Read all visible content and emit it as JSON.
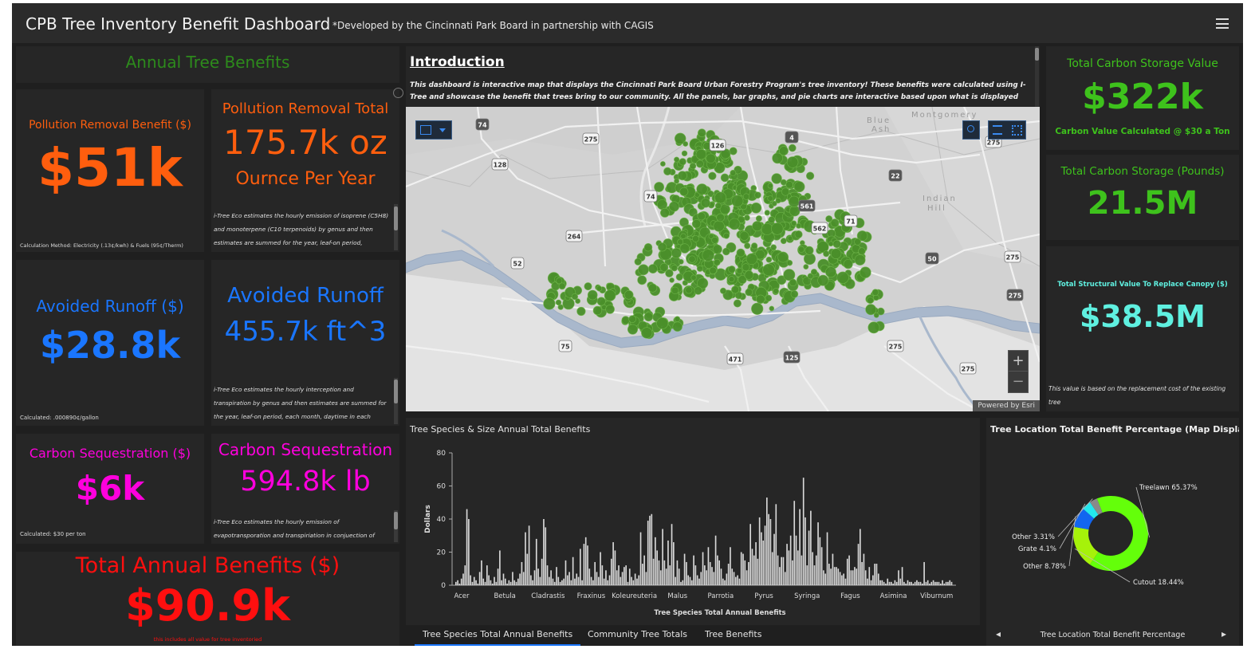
{
  "header": {
    "title": "CPB Tree Inventory Benefit Dashboard",
    "subtitle": "*Developed by the Cincinnati Park Board in partnership with CAGIS"
  },
  "annual_benefits": {
    "title": "Annual Tree Benefits"
  },
  "pollution_benefit": {
    "label": "Pollution Removal Benefit ($)",
    "value": "$51k",
    "method": "Calculation Method: Electricity (.13¢/kwh) & Fuels (95¢/Therm)"
  },
  "pollution_total": {
    "label": "Pollution Removal Total",
    "value": "175.7k oz",
    "unit": "Ournce Per Year",
    "note": "i-Tree Eco estimates the hourly emission of isoprene (C5H8) and monoterpene (C10 terpenoids) by genus and then estimates are summed for the year, leaf-on period,"
  },
  "runoff_benefit": {
    "label": "Avoided Runoff ($)",
    "value": "$28.8k",
    "method": "Calculated: .000890¢/gallon"
  },
  "runoff_total": {
    "label": "Avoided Runoff",
    "value": "455.7k ft^3",
    "note": "i-Tree Eco estimates the hourly interception and transpiration by genus and then  estimates are summed for the year, leaf-on period, each month, daytime in each"
  },
  "carbon_seq_benefit": {
    "label": "Carbon Sequestration ($)",
    "value": "$6k",
    "method": "Calculated: $30 per ton"
  },
  "carbon_seq_total": {
    "label": "Carbon Sequestration",
    "value": "594.8k lb",
    "note": "i-Tree Eco estimates the hourly emission of evapotransporation and transpiriation in conjuection of"
  },
  "total_benefits": {
    "label": "Total Annual Benefits ($)",
    "value": "$90.9k",
    "note": "this includes all value for tree inventoried"
  },
  "intro": {
    "title": "Introduction",
    "text": "This dashboard is interactive map that displays the Cincinnati Park Board Urban Forestry Program's tree inventory! These benefits were calculated using I-Tree and showcase the benefit that  trees bring to our community. All the panels, bar graphs, and pie charts are interactive based upon what is displayed within the"
  },
  "map": {
    "attribution": "Powered by Esri",
    "zoom_in": "+",
    "zoom_out": "−",
    "place_labels": [
      "Blue",
      "Ash",
      "Montgomery",
      "Indian",
      "Hill"
    ],
    "shields": [
      "74",
      "275",
      "126",
      "4",
      "128",
      "74",
      "22",
      "275",
      "264",
      "561",
      "71",
      "562",
      "50",
      "275",
      "52",
      "275",
      "75",
      "471",
      "125",
      "275",
      "275"
    ],
    "tree_color": "#4a8f2a"
  },
  "carbon_storage_value": {
    "label": "Total Carbon Storage Value",
    "value": "$322k",
    "note": "Carbon Value Calculated @ $30 a Ton"
  },
  "carbon_storage_pounds": {
    "label": "Total Carbon Storage (Pounds)",
    "value": "21.5M"
  },
  "structural_value": {
    "label": "Total Structural Value To Replace Canopy ($)",
    "value": "$38.5M",
    "note": "This value is based on the replacement cost of the existing tree"
  },
  "bar_chart_panel": {
    "title": "Tree Species & Size Annual Total Benefits"
  },
  "pie_panel": {
    "title": "Tree Location Total Benefit Percentage (Map Display)"
  },
  "tabs": {
    "t1": "Tree Species Total Annual Benefits",
    "t2": "Community Tree Totals",
    "t3": "Tree Benefits"
  },
  "pie_nav": {
    "label": "Tree Location Total Benefit Percentage",
    "prev": "◂",
    "next": "▸"
  },
  "chart_data": [
    {
      "type": "bar",
      "title": "",
      "xlabel": "Tree Species Total Annual Benefits",
      "ylabel": "Dollars",
      "ylim": [
        0,
        80
      ],
      "yticks": [
        0,
        20,
        40,
        60,
        80
      ],
      "grid": false,
      "categories": [
        "Acer",
        "Betula",
        "Cladrastis",
        "Fraxinus",
        "Koleureuteria",
        "Malus",
        "Parrotia",
        "Pyrus",
        "Syringa",
        "Fagus",
        "Asimina",
        "Viburnum"
      ],
      "series": [
        {
          "color": "#d9d9d9",
          "values": [
            2,
            3,
            1,
            4,
            7,
            12,
            46,
            40,
            6,
            2,
            5,
            3,
            1,
            8,
            15,
            4,
            2,
            12,
            6,
            3,
            1,
            5,
            2,
            10,
            21,
            3,
            7,
            4,
            1,
            3,
            2,
            8,
            3,
            2,
            4,
            7,
            14,
            8,
            32,
            19,
            36,
            6,
            3,
            9,
            28,
            10,
            5,
            16,
            40,
            35,
            12,
            5,
            9,
            4,
            2,
            11,
            5,
            2,
            3,
            4,
            15,
            6,
            8,
            3,
            17,
            4,
            7,
            5,
            22,
            3,
            25,
            29,
            24,
            10,
            5,
            3,
            14,
            8,
            5,
            20,
            12,
            4,
            9,
            3,
            6,
            16,
            26,
            21,
            9,
            12,
            5,
            8,
            11,
            12,
            2,
            10,
            5,
            3,
            7,
            4,
            6,
            32,
            13,
            18,
            8,
            39,
            42,
            43,
            16,
            29,
            21,
            15,
            9,
            34,
            15,
            10,
            27,
            12,
            37,
            26,
            5,
            15,
            10,
            2,
            3,
            19,
            14,
            6,
            5,
            3,
            18,
            12,
            6,
            4,
            8,
            20,
            12,
            9,
            23,
            14,
            11,
            8,
            30,
            18,
            15,
            10,
            4,
            3,
            7,
            13,
            23,
            10,
            8,
            5,
            6,
            4,
            20,
            19,
            15,
            9,
            14,
            37,
            22,
            18,
            26,
            16,
            41,
            32,
            27,
            36,
            53,
            43,
            40,
            20,
            31,
            49,
            18,
            11,
            17,
            17,
            8,
            25,
            21,
            30,
            15,
            51,
            30,
            21,
            46,
            18,
            65,
            41,
            12,
            33,
            45,
            20,
            12,
            18,
            38,
            29,
            23,
            9,
            7,
            32,
            13,
            10,
            19,
            11,
            11,
            10,
            8,
            6,
            7,
            4,
            16,
            18,
            9,
            9,
            11,
            10,
            25,
            34,
            14,
            19,
            9,
            4,
            11,
            3,
            6,
            13,
            13,
            7,
            3,
            3,
            2,
            1,
            4,
            2,
            2,
            1,
            3,
            2,
            9,
            4,
            11,
            2,
            1,
            3,
            2,
            2,
            1,
            2,
            3,
            2,
            2,
            1,
            14,
            2,
            3,
            1,
            2,
            3,
            2,
            2,
            2,
            1,
            3,
            1,
            2,
            2,
            3,
            2
          ]
        }
      ]
    },
    {
      "type": "pie",
      "title": "",
      "donut": true,
      "categories": [
        "Treelawn",
        "Cutout",
        "Other",
        "Grate",
        "Other"
      ],
      "values": [
        65.37,
        18.44,
        8.78,
        4.1,
        3.31
      ],
      "labels": [
        "Treelawn 65.37%",
        "Cutout 18.44%",
        "Other 8.78%",
        "Grate 4.1%",
        "Other 3.31%"
      ],
      "colors": [
        "#64ff0a",
        "#a6f20a",
        "#1266f0",
        "#23e8ee",
        "#8a8a8a"
      ]
    }
  ]
}
